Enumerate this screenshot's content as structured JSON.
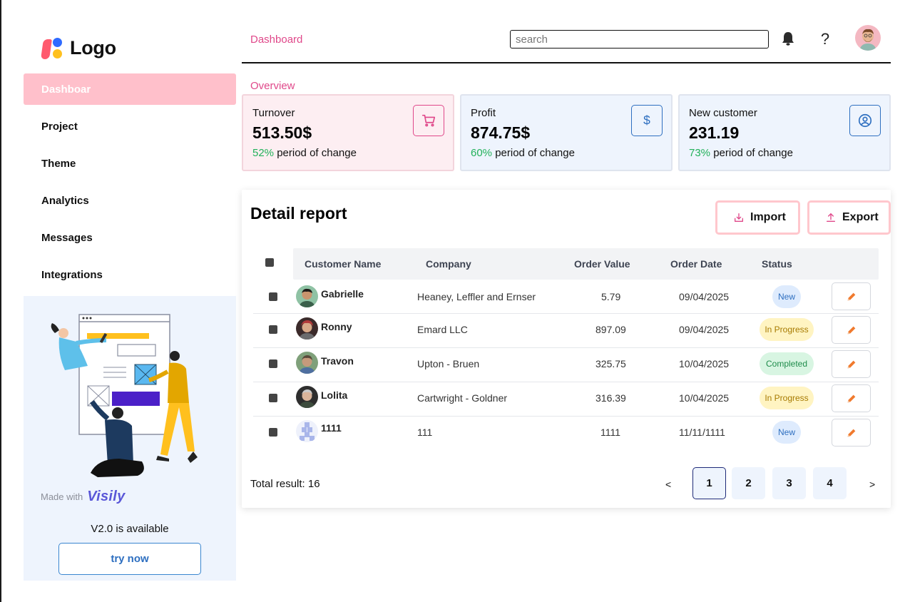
{
  "sidebar": {
    "logo_text": "Logo",
    "nav": [
      {
        "label": "Dashboar",
        "active": true
      },
      {
        "label": "Project"
      },
      {
        "label": "Theme"
      },
      {
        "label": "Analytics"
      },
      {
        "label": "Messages"
      },
      {
        "label": "Integrations"
      }
    ],
    "promo": {
      "made_with": "Made with",
      "brand": "Visily",
      "version": "V2.0 is available",
      "cta": "try now"
    }
  },
  "header": {
    "breadcrumb": "Dashboard",
    "search_placeholder": "search",
    "help": "?"
  },
  "overview": {
    "label": "Overview",
    "cards": [
      {
        "label": "Turnover",
        "value": "513.50$",
        "pct": "52%",
        "change": "period of change",
        "icon": "cart-icon"
      },
      {
        "label": "Profit",
        "value": "874.75$",
        "pct": "60%",
        "change": "period of change",
        "icon": "dollar-icon"
      },
      {
        "label": "New customer",
        "value": "231.19",
        "pct": "73%",
        "change": "period of change",
        "icon": "user-circle-icon"
      }
    ]
  },
  "report": {
    "title": "Detail report",
    "import_label": "Import",
    "export_label": "Export",
    "columns": [
      "Customer Name",
      "Company",
      "Order Value",
      "Order Date",
      "Status"
    ],
    "rows": [
      {
        "name": "Gabrielle",
        "company": "Heaney, Leffler and Ernser",
        "value": "5.79",
        "date": "09/04/2025",
        "status": "New"
      },
      {
        "name": "Ronny",
        "company": "Emard LLC",
        "value": "897.09",
        "date": "09/04/2025",
        "status": "In Progress"
      },
      {
        "name": "Travon",
        "company": "Upton - Bruen",
        "value": "325.75",
        "date": "10/04/2025",
        "status": "Completed"
      },
      {
        "name": "Lolita",
        "company": "Cartwright - Goldner",
        "value": "316.39",
        "date": "10/04/2025",
        "status": "In Progress"
      },
      {
        "name": "1111",
        "company": "111",
        "value": "1111",
        "date": "11/11/1111",
        "status": "New"
      }
    ],
    "total": "Total result: 16",
    "pager": {
      "prev": "<",
      "next": ">",
      "pages": [
        "1",
        "2",
        "3",
        "4"
      ],
      "current": "1"
    }
  },
  "colors": {
    "accent_pink": "#e0488a",
    "nav_active": "#ffc0cb",
    "card_blue": "#eef4fd",
    "positive": "#22b15a"
  }
}
